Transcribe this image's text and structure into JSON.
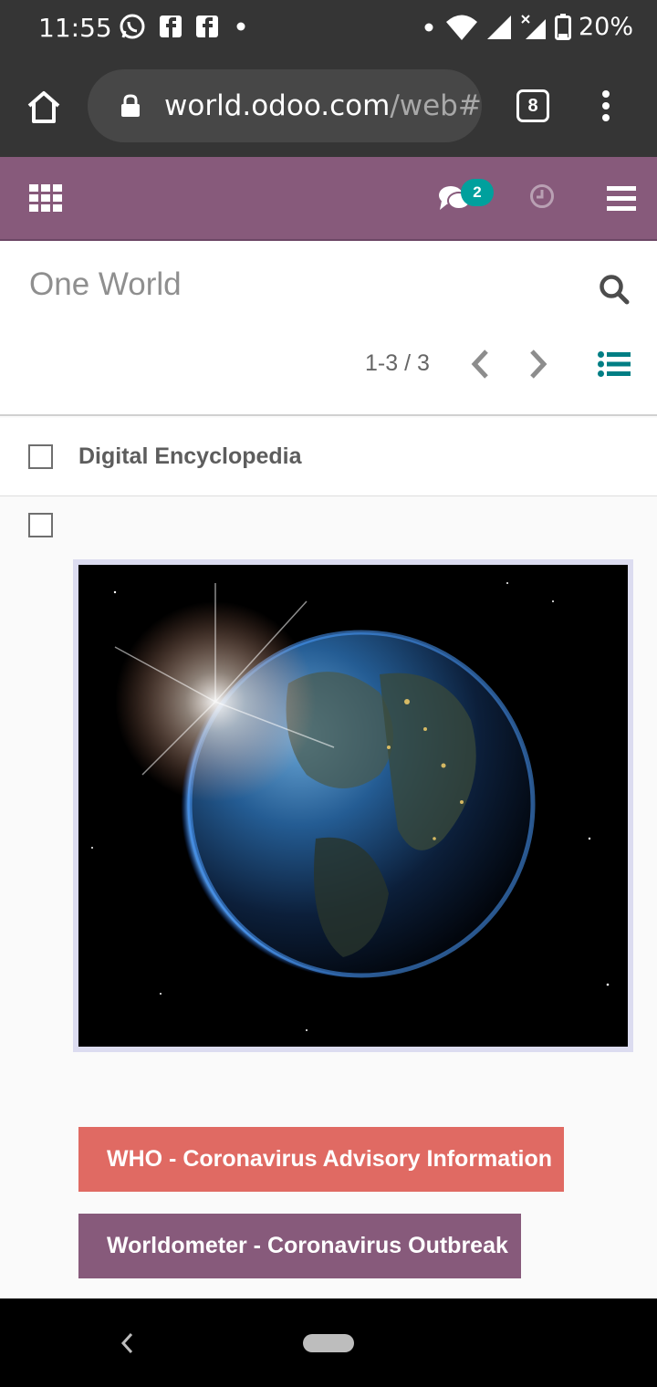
{
  "status_bar": {
    "time": "11:55",
    "battery": "20%",
    "left_icons": [
      "whatsapp-icon",
      "facebook-icon",
      "facebook-icon",
      "dot-icon"
    ],
    "right_icons": [
      "dot-icon",
      "wifi-icon",
      "signal-icon",
      "signal-x-icon",
      "battery-icon"
    ]
  },
  "browser": {
    "url_domain": "world.odoo.com",
    "url_path": "/web#a",
    "tab_count": "8"
  },
  "odoo_nav": {
    "chat_badge_count": "2",
    "colors": {
      "nav": "#875a7b",
      "badge": "#00a09d"
    }
  },
  "control_panel": {
    "breadcrumb": "One World",
    "pager": "1-3 / 3"
  },
  "list": {
    "header_label": "Digital Encyclopedia",
    "buttons": [
      {
        "label": "WHO - Coronavirus Advisory Information",
        "color": "#e06a63"
      },
      {
        "label": "Worldometer - Coronavirus Outbreak",
        "color": "#875a7b"
      }
    ]
  }
}
